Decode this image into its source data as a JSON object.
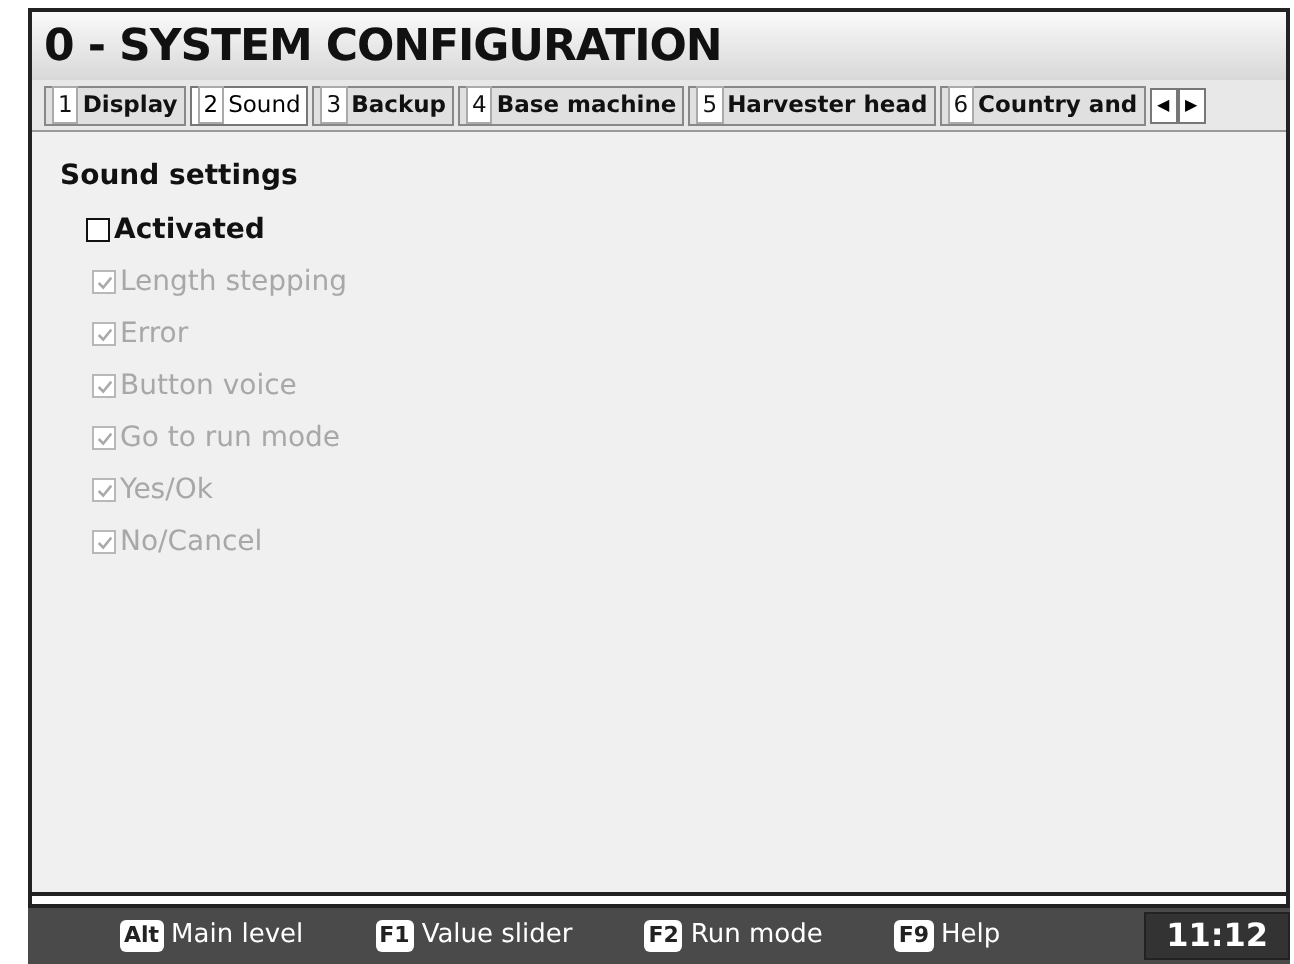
{
  "window": {
    "title": "0 - SYSTEM CONFIGURATION"
  },
  "tabs": [
    {
      "key": "1",
      "label": "Display",
      "selected": false
    },
    {
      "key": "2",
      "label": "Sound",
      "selected": true
    },
    {
      "key": "3",
      "label": "Backup",
      "selected": false
    },
    {
      "key": "4",
      "label": "Base machine",
      "selected": false
    },
    {
      "key": "5",
      "label": "Harvester head",
      "selected": false
    },
    {
      "key": "6",
      "label": "Country and",
      "selected": false
    }
  ],
  "tab_scroll": {
    "left": "◀",
    "right": "▶"
  },
  "section": {
    "title": "Sound settings",
    "options": [
      {
        "label": "Activated",
        "checked": false,
        "disabled": false,
        "children": [
          {
            "label": "Length stepping",
            "checked": true,
            "disabled": true
          },
          {
            "label": "Error",
            "checked": true,
            "disabled": true
          },
          {
            "label": "Button voice",
            "checked": true,
            "disabled": true
          },
          {
            "label": "Go to run mode",
            "checked": true,
            "disabled": true
          },
          {
            "label": "Yes/Ok",
            "checked": true,
            "disabled": true
          },
          {
            "label": "No/Cancel",
            "checked": true,
            "disabled": true
          }
        ]
      }
    ]
  },
  "status_bar": {
    "shortcuts": [
      {
        "key": "Alt",
        "label": "Main level"
      },
      {
        "key": "F1",
        "label": "Value slider"
      },
      {
        "key": "F2",
        "label": "Run mode"
      },
      {
        "key": "F9",
        "label": "Help"
      }
    ],
    "time": "11:12"
  }
}
